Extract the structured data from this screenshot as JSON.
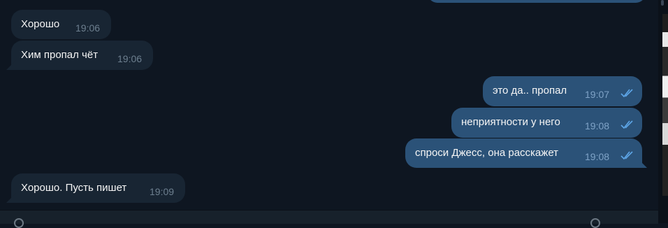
{
  "messages": [
    {
      "text": "Хорошо",
      "time": "19:06"
    },
    {
      "text": "Хим пропал чёт",
      "time": "19:06"
    },
    {
      "text": "это да.. пропал",
      "time": "19:07"
    },
    {
      "text": "неприятности у него",
      "time": "19:08"
    },
    {
      "text": "спроси Джесс, она расскажет",
      "time": "19:08"
    },
    {
      "text": "Хорошо. Пусть пишет",
      "time": "19:09"
    }
  ],
  "colors": {
    "background": "#0e1621",
    "incoming_bubble": "#182533",
    "outgoing_bubble": "#2b5278",
    "read_ticks": "#5ea6e8"
  },
  "icons": {
    "read_receipt": "double-check-icon"
  }
}
